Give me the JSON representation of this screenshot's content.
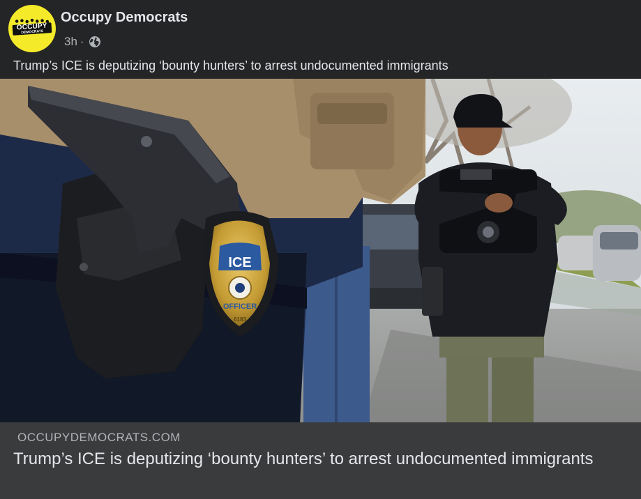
{
  "post": {
    "page_name": "Occupy Democrats",
    "timestamp": "3h",
    "separator": "·",
    "audience_icon": "globe-icon",
    "caption": "Trump’s ICE is deputizing ‘bounty hunters’ to arrest undocumented immigrants"
  },
  "avatar": {
    "logo_text": "OCCUPY",
    "logo_subtext": "DEMOCRATS",
    "background": "#f5ea2a"
  },
  "photo": {
    "badge_top_text": "ICE",
    "badge_bottom_text": "OFFICER",
    "badge_number": "6183"
  },
  "link_preview": {
    "domain": "OCCUPYDEMOCRATS.COM",
    "title": "Trump’s ICE is deputizing ‘bounty hunters’ to arrest undocumented immigrants"
  },
  "colors": {
    "background": "#242526",
    "preview_background": "#3a3b3c",
    "primary_text": "#e4e6eb",
    "secondary_text": "#b0b3b8"
  }
}
